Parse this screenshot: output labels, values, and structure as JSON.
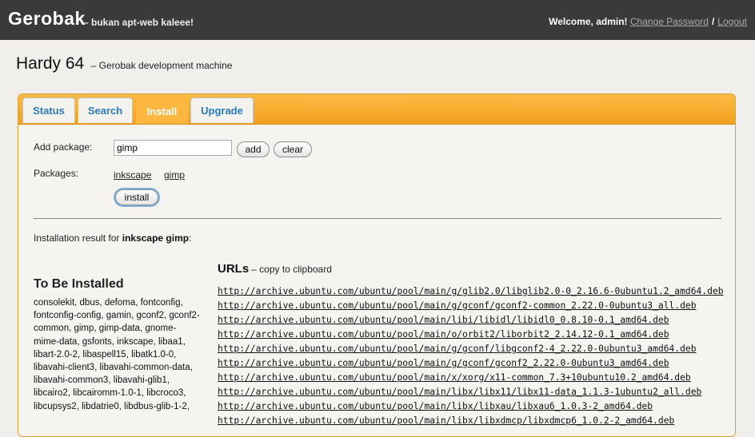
{
  "header": {
    "brand": "Gerobak",
    "tagline": "– bukan apt-web kaleee!",
    "welcome": "Welcome, admin!",
    "change_password": "Change Password",
    "separator": "/",
    "logout": "Logout"
  },
  "page": {
    "title": "Hardy 64",
    "subtitle": "– Gerobak development machine"
  },
  "tabs": [
    {
      "label": "Status",
      "active": false
    },
    {
      "label": "Search",
      "active": false
    },
    {
      "label": "Install",
      "active": true
    },
    {
      "label": "Upgrade",
      "active": false
    }
  ],
  "form": {
    "add_label": "Add package:",
    "input_value": "gimp",
    "add_button": "add",
    "clear_button": "clear",
    "packages_label": "Packages:",
    "packages": [
      "inkscape",
      "gimp"
    ],
    "install_button": "install"
  },
  "result": {
    "prefix": "Installation result for",
    "query": "inkscape gimp",
    "suffix": ":"
  },
  "to_be_installed": {
    "heading": "To Be Installed",
    "list": "consolekit, dbus, defoma, fontconfig, fontconfig-config, gamin, gconf2, gconf2-common, gimp, gimp-data, gnome-mime-data, gsfonts, inkscape, libaa1, libart-2.0-2, libaspell15, libatk1.0-0, libavahi-client3, libavahi-common-data, libavahi-common3, libavahi-glib1, libcairo2, libcairomm-1.0-1, libcroco3, libcupsys2, libdatrie0, libdbus-glib-1-2,"
  },
  "urls": {
    "heading": "URLs",
    "copy_label": "– copy to clipboard",
    "items": [
      "http://archive.ubuntu.com/ubuntu/pool/main/g/glib2.0/libglib2.0-0_2.16.6-0ubuntu1.2_amd64.deb",
      "http://archive.ubuntu.com/ubuntu/pool/main/g/gconf/gconf2-common_2.22.0-0ubuntu3_all.deb",
      "http://archive.ubuntu.com/ubuntu/pool/main/libi/libidl/libidl0_0.8.10-0.1_amd64.deb",
      "http://archive.ubuntu.com/ubuntu/pool/main/o/orbit2/liborbit2_2.14.12-0.1_amd64.deb",
      "http://archive.ubuntu.com/ubuntu/pool/main/g/gconf/libgconf2-4_2.22.0-0ubuntu3_amd64.deb",
      "http://archive.ubuntu.com/ubuntu/pool/main/g/gconf/gconf2_2.22.0-0ubuntu3_amd64.deb",
      "http://archive.ubuntu.com/ubuntu/pool/main/x/xorg/x11-common_7.3+10ubuntu10.2_amd64.deb",
      "http://archive.ubuntu.com/ubuntu/pool/main/libx/libx11/libx11-data_1.1.3-1ubuntu2_all.deb",
      "http://archive.ubuntu.com/ubuntu/pool/main/libx/libxau/libxau6_1.0.3-2_amd64.deb",
      "http://archive.ubuntu.com/ubuntu/pool/main/libx/libxdmcp/libxdmcp6_1.0.2-2_amd64.deb"
    ]
  },
  "colors": {
    "topbar": "#3a3a3a",
    "tabbar": "#f6a923",
    "tab_text": "#2a7bb5",
    "active_tab": "#fbb740"
  }
}
